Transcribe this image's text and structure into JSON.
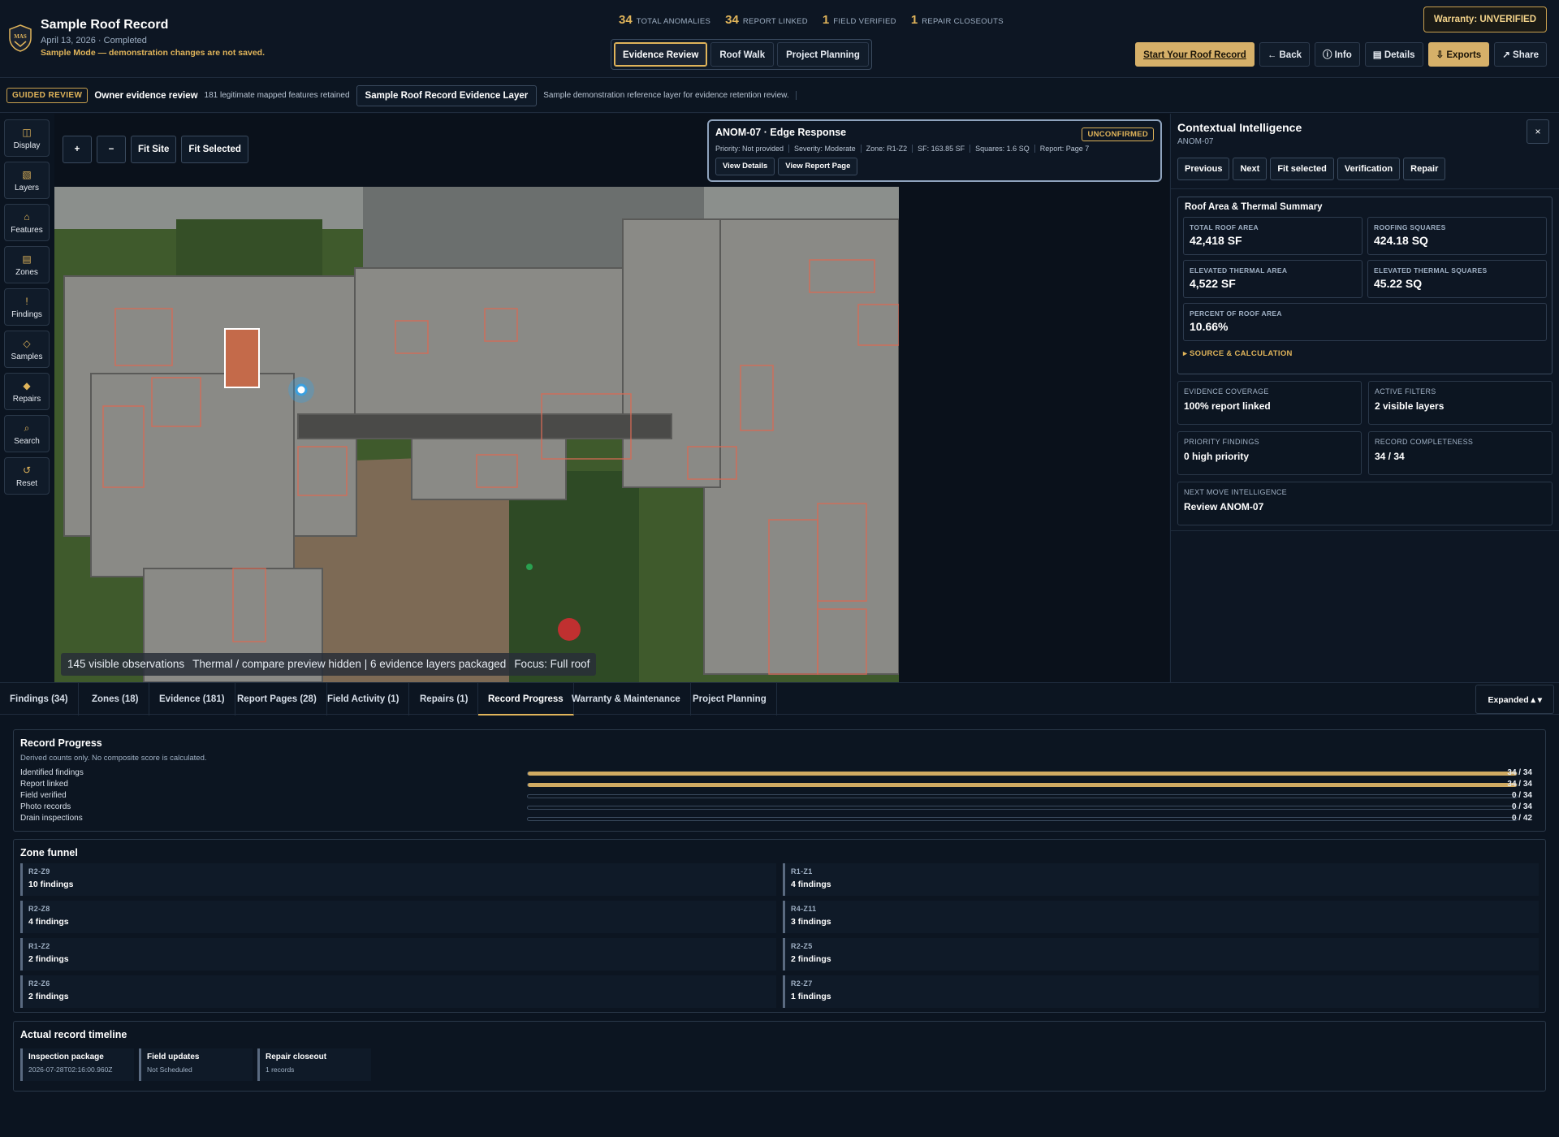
{
  "header": {
    "title": "Sample Roof Record",
    "subtitle": "April 13, 2026 · Completed",
    "mode_note": "Sample Mode — demonstration changes are not saved.",
    "logo_text": "MAS",
    "stats": [
      {
        "num": "34",
        "label": "Total Anomalies"
      },
      {
        "num": "34",
        "label": "Report Linked"
      },
      {
        "num": "1",
        "label": "Field Verified"
      },
      {
        "num": "1",
        "label": "Repair Closeouts"
      }
    ],
    "mode_tabs": [
      "Evidence Review",
      "Roof Walk",
      "Project Planning"
    ],
    "warranty": "Warranty: UNVERIFIED",
    "buttons": {
      "start": "Start Your Roof Record",
      "back": "← Back",
      "info": "ⓘ Info",
      "details": "▤ Details",
      "exports": "⇩ Exports",
      "share": "↗ Share"
    }
  },
  "guide": {
    "badge": "GUIDED REVIEW",
    "title": "Owner evidence review",
    "sub": "181 legitimate mapped features retained",
    "layer": "Sample Roof Record Evidence Layer",
    "desc": "Sample demonstration reference layer for evidence retention review."
  },
  "rail": [
    {
      "icon": "display-icon",
      "glyph": "◫",
      "label": "Display"
    },
    {
      "icon": "layers-icon",
      "glyph": "▧",
      "label": "Layers"
    },
    {
      "icon": "features-icon",
      "glyph": "⌂",
      "label": "Features"
    },
    {
      "icon": "zones-icon",
      "glyph": "▤",
      "label": "Zones"
    },
    {
      "icon": "findings-icon",
      "glyph": "!",
      "label": "Findings"
    },
    {
      "icon": "samples-icon",
      "glyph": "◇",
      "label": "Samples"
    },
    {
      "icon": "repairs-icon",
      "glyph": "◆",
      "label": "Repairs"
    },
    {
      "icon": "search-icon",
      "glyph": "⌕",
      "label": "Search"
    },
    {
      "icon": "reset-icon",
      "glyph": "↺",
      "label": "Reset"
    }
  ],
  "map": {
    "controls": {
      "zoom_in": "+",
      "zoom_out": "−",
      "fit_site": "Fit Site",
      "fit_selected": "Fit Selected"
    },
    "status": [
      "145 visible observations",
      "Thermal / compare preview hidden | 6 evidence layers packaged",
      "Focus: Full roof"
    ]
  },
  "anomaly": {
    "title": "ANOM-07 · Edge Response",
    "badge": "UNCONFIRMED",
    "meta": [
      "Priority: Not provided",
      "Severity: Moderate",
      "Zone: R1-Z2",
      "SF: 163.85 SF",
      "Squares: 1.6 SQ",
      "Report: Page 7"
    ],
    "view_details": "View Details",
    "view_report": "View Report Page"
  },
  "context": {
    "title": "Contextual Intelligence",
    "sub": "ANOM-07",
    "close": "×",
    "nav": [
      "Previous",
      "Next",
      "Fit selected",
      "Verification",
      "Repair"
    ],
    "thermal_title": "Roof Area & Thermal Summary",
    "thermal": [
      {
        "k": "TOTAL ROOF AREA",
        "v": "42,418 SF"
      },
      {
        "k": "ROOFING SQUARES",
        "v": "424.18 SQ"
      },
      {
        "k": "ELEVATED THERMAL AREA",
        "v": "4,522 SF"
      },
      {
        "k": "ELEVATED THERMAL SQUARES",
        "v": "45.22 SQ"
      },
      {
        "k": "PERCENT OF ROOF AREA",
        "v": "10.66%"
      }
    ],
    "source_calc": "▸ SOURCE & CALCULATION",
    "cards": [
      {
        "k": "EVIDENCE COVERAGE",
        "v": "100% report linked"
      },
      {
        "k": "ACTIVE FILTERS",
        "v": "2 visible layers"
      },
      {
        "k": "PRIORITY FINDINGS",
        "v": "0 high priority"
      },
      {
        "k": "RECORD COMPLETENESS",
        "v": "34 / 34"
      },
      {
        "k": "NEXT MOVE INTELLIGENCE",
        "v": "Review ANOM-07"
      }
    ]
  },
  "tabs": [
    "Findings (34)",
    "Zones (18)",
    "Evidence (181)",
    "Report Pages (28)",
    "Field Activity (1)",
    "Repairs (1)",
    "Record Progress",
    "Warranty & Maintenance",
    "Project Planning"
  ],
  "expanded": "Expanded ▴ ▾",
  "progress": {
    "title": "Record Progress",
    "sub": "Derived counts only. No composite score is calculated.",
    "rows": [
      {
        "label": "Identified findings",
        "value": "34 / 34",
        "fraction": 1.0
      },
      {
        "label": "Report linked",
        "value": "34 / 34",
        "fraction": 1.0
      },
      {
        "label": "Field verified",
        "value": "0 / 34",
        "fraction": 0
      },
      {
        "label": "Photo records",
        "value": "0 / 34",
        "fraction": 0
      },
      {
        "label": "Drain inspections",
        "value": "0 / 42",
        "fraction": 0
      }
    ]
  },
  "funnel": {
    "title": "Zone funnel",
    "zones": [
      {
        "zone": "R2-Z9",
        "count": "10 findings"
      },
      {
        "zone": "R1-Z1",
        "count": "4 findings"
      },
      {
        "zone": "R2-Z8",
        "count": "4 findings"
      },
      {
        "zone": "R4-Z11",
        "count": "3 findings"
      },
      {
        "zone": "R1-Z2",
        "count": "2 findings"
      },
      {
        "zone": "R2-Z5",
        "count": "2 findings"
      },
      {
        "zone": "R2-Z6",
        "count": "2 findings"
      },
      {
        "zone": "R2-Z7",
        "count": "1 findings"
      }
    ]
  },
  "timeline": {
    "title": "Actual record timeline",
    "items": [
      {
        "name": "Inspection package",
        "value": "2026-07-28T02:16:00.960Z"
      },
      {
        "name": "Field updates",
        "value": "Not Scheduled"
      },
      {
        "name": "Repair closeout",
        "value": "1 records"
      }
    ]
  }
}
